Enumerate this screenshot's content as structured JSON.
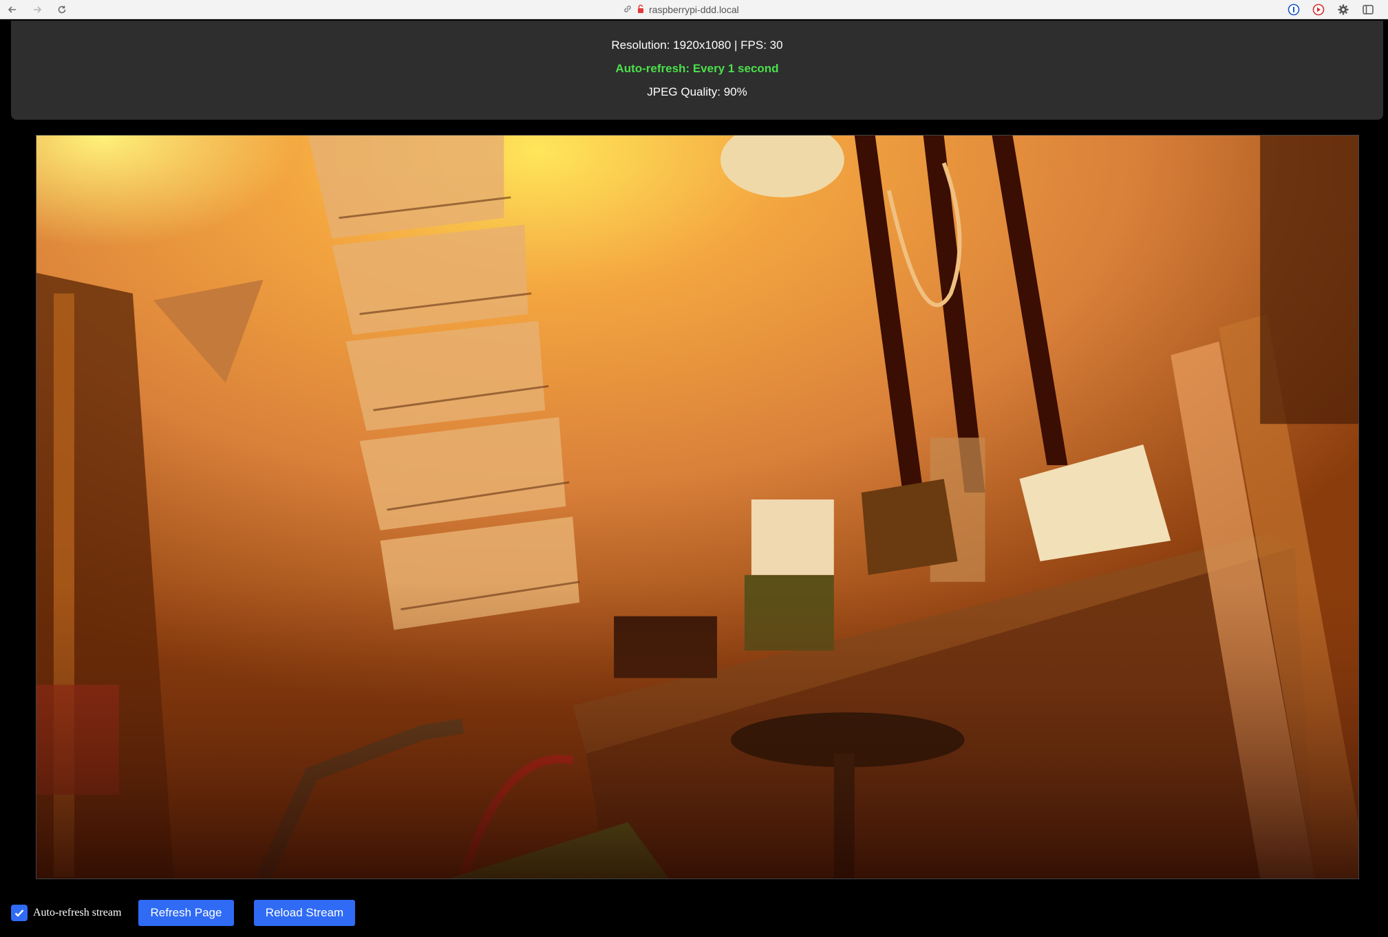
{
  "browser": {
    "url": "raspberrypi-ddd.local",
    "back_icon": "back-arrow-icon",
    "forward_icon": "forward-arrow-icon",
    "reload_icon": "reload-icon"
  },
  "info": {
    "resolution_line": "Resolution: 1920x1080 | FPS: 30",
    "autorefresh_line": "Auto-refresh: Every 1 second",
    "quality_line": "JPEG Quality: 90%"
  },
  "stream": {
    "description_icon": "camera-stream-image"
  },
  "controls": {
    "autorefresh_label": "Auto-refresh stream",
    "autorefresh_checked": true,
    "refresh_page_label": "Refresh Page",
    "reload_stream_label": "Reload Stream"
  },
  "colors": {
    "accent": "#2f6bf5",
    "green_status": "#4be04b",
    "panel": "#2e2e2e"
  }
}
